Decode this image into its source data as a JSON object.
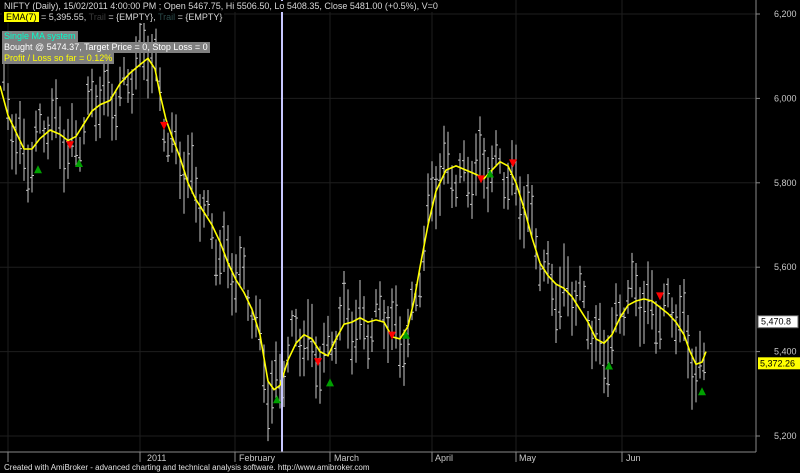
{
  "header": {
    "quote": "NIFTY (Daily), 15/02/2011 4:00:00 PM ; Open 5467.75, Hi 5506.50, Lo 5408.35, Close 5481.00 (+0.5%), V=0",
    "ema_label": "EMA(7)",
    "ema_value": " = 5,395.55,",
    "hidden1": "Trail",
    "empty1": " = {EMPTY},",
    "hidden2": "Trail",
    "empty2": " = {EMPTY}"
  },
  "system_box": {
    "title": "Single MA system",
    "bought": "Bought @ 5474.37, Target Price = 0, Stop Loss = 0",
    "pl": "Profit / Loss so far = 0.12%"
  },
  "footer": "Created with AmiBroker - advanced charting and technical analysis software. http://www.amibroker.com",
  "colors": {
    "background": "#000000",
    "bars": "#c8c8c8",
    "ema": "#ffff00",
    "buy": "#00a000",
    "sell": "#ff0000",
    "cursor": "#c8c8ff"
  },
  "chart_data": {
    "type": "line",
    "yaxis_labels": [
      "6,200",
      "6,000",
      "5,800",
      "5,600",
      "5,400",
      "5,200"
    ],
    "yaxis_ticks": [
      6200,
      6000,
      5800,
      5600,
      5400,
      5200
    ],
    "ylim": [
      5160,
      6240
    ],
    "x_labels": [
      "2011",
      "February",
      "March",
      "April",
      "May",
      "Jun"
    ],
    "last_price_label": "5,470.8",
    "last_price": 5470.8,
    "ema_last_label": "5,372.26",
    "ema_last": 5372.26,
    "ema_series": [
      [
        0,
        6030
      ],
      [
        8,
        5960
      ],
      [
        16,
        5920
      ],
      [
        24,
        5880
      ],
      [
        32,
        5880
      ],
      [
        40,
        5905
      ],
      [
        50,
        5925
      ],
      [
        60,
        5915
      ],
      [
        68,
        5900
      ],
      [
        76,
        5910
      ],
      [
        84,
        5940
      ],
      [
        92,
        5970
      ],
      [
        100,
        5985
      ],
      [
        110,
        5995
      ],
      [
        120,
        6035
      ],
      [
        130,
        6060
      ],
      [
        140,
        6080
      ],
      [
        148,
        6095
      ],
      [
        155,
        6070
      ],
      [
        160,
        6010
      ],
      [
        166,
        5950
      ],
      [
        172,
        5910
      ],
      [
        180,
        5860
      ],
      [
        188,
        5800
      ],
      [
        196,
        5760
      ],
      [
        204,
        5730
      ],
      [
        212,
        5700
      ],
      [
        220,
        5660
      ],
      [
        228,
        5610
      ],
      [
        236,
        5570
      ],
      [
        244,
        5540
      ],
      [
        252,
        5500
      ],
      [
        260,
        5440
      ],
      [
        268,
        5330
      ],
      [
        274,
        5310
      ],
      [
        280,
        5320
      ],
      [
        288,
        5380
      ],
      [
        296,
        5420
      ],
      [
        304,
        5440
      ],
      [
        312,
        5430
      ],
      [
        320,
        5400
      ],
      [
        328,
        5390
      ],
      [
        336,
        5430
      ],
      [
        344,
        5465
      ],
      [
        352,
        5470
      ],
      [
        360,
        5480
      ],
      [
        368,
        5470
      ],
      [
        376,
        5475
      ],
      [
        384,
        5470
      ],
      [
        392,
        5435
      ],
      [
        400,
        5430
      ],
      [
        408,
        5460
      ],
      [
        414,
        5520
      ],
      [
        420,
        5600
      ],
      [
        428,
        5700
      ],
      [
        436,
        5780
      ],
      [
        446,
        5830
      ],
      [
        456,
        5840
      ],
      [
        466,
        5830
      ],
      [
        476,
        5820
      ],
      [
        484,
        5810
      ],
      [
        492,
        5830
      ],
      [
        500,
        5850
      ],
      [
        508,
        5840
      ],
      [
        516,
        5800
      ],
      [
        524,
        5740
      ],
      [
        532,
        5670
      ],
      [
        540,
        5610
      ],
      [
        548,
        5580
      ],
      [
        556,
        5560
      ],
      [
        564,
        5550
      ],
      [
        572,
        5530
      ],
      [
        580,
        5500
      ],
      [
        588,
        5470
      ],
      [
        596,
        5430
      ],
      [
        604,
        5420
      ],
      [
        612,
        5440
      ],
      [
        620,
        5480
      ],
      [
        628,
        5510
      ],
      [
        636,
        5520
      ],
      [
        644,
        5525
      ],
      [
        652,
        5520
      ],
      [
        660,
        5505
      ],
      [
        668,
        5490
      ],
      [
        676,
        5470
      ],
      [
        684,
        5440
      ],
      [
        690,
        5400
      ],
      [
        696,
        5370
      ],
      [
        702,
        5375
      ],
      [
        706,
        5400
      ]
    ],
    "buy_signals": [
      [
        38,
        5832
      ],
      [
        79,
        5847
      ],
      [
        277,
        5287
      ],
      [
        330,
        5327
      ],
      [
        406,
        5440
      ],
      [
        490,
        5822
      ],
      [
        609,
        5367
      ],
      [
        702,
        5306
      ]
    ],
    "sell_signals": [
      [
        70,
        5889
      ],
      [
        164,
        5935
      ],
      [
        318,
        5375
      ],
      [
        392,
        5438
      ],
      [
        481,
        5808
      ],
      [
        513,
        5846
      ],
      [
        660,
        5531
      ]
    ]
  }
}
